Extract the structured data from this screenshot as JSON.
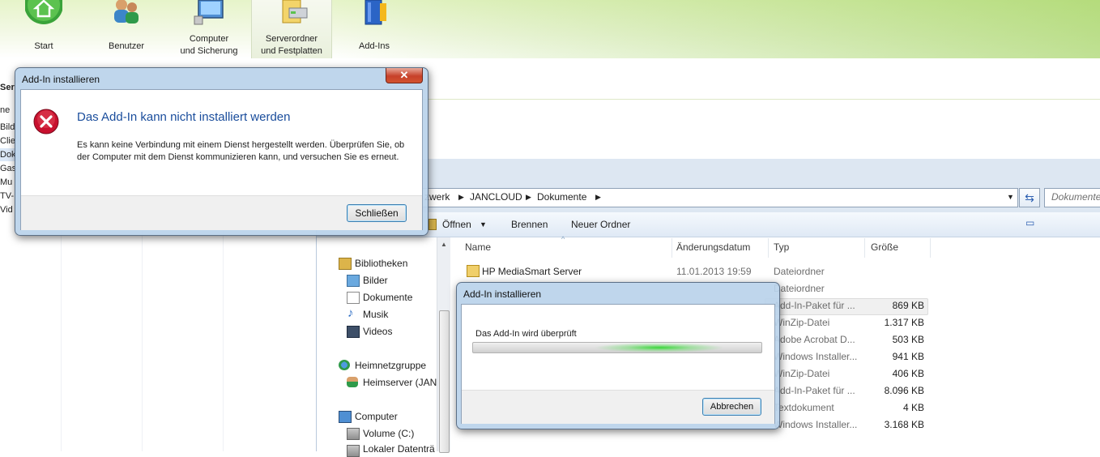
{
  "toolbar": {
    "items": [
      {
        "label": "Start",
        "icon": "home-icon"
      },
      {
        "label": "Benutzer",
        "icon": "users-icon"
      },
      {
        "label": "Computer\nund Sicherung",
        "line1": "Computer",
        "line2": "und Sicherung",
        "icon": "computer-icon"
      },
      {
        "label": "Serverordner und Festplatten",
        "line1": "Serverordner",
        "line2": "und Festplatten",
        "icon": "server-folder-icon"
      },
      {
        "label": "Add-Ins",
        "icon": "addins-icon"
      }
    ]
  },
  "dashboard_left": {
    "heading": "Ser",
    "subheading": "ne",
    "items": [
      "Bild",
      "Clie",
      "Dok",
      "Gas",
      "Mu",
      "TV-",
      "Vid"
    ]
  },
  "explorer": {
    "breadcrumb": [
      "zwerk",
      "JANCLOUD",
      "Dokumente"
    ],
    "search_placeholder": "Dokumente",
    "commands": [
      "Öffnen",
      "Brennen",
      "Neuer Ordner"
    ],
    "nav": {
      "groups": [
        {
          "label": "Bibliotheken",
          "icon": "library-icon",
          "items": [
            {
              "label": "Bilder",
              "icon": "pictures-icon"
            },
            {
              "label": "Dokumente",
              "icon": "documents-icon"
            },
            {
              "label": "Musik",
              "icon": "music-icon"
            },
            {
              "label": "Videos",
              "icon": "videos-icon"
            }
          ]
        },
        {
          "label": "Heimnetzgruppe",
          "icon": "homegroup-icon",
          "items": [
            {
              "label": "Heimserver (JAN",
              "icon": "user-icon"
            }
          ]
        },
        {
          "label": "Computer",
          "icon": "computer-icon",
          "items": [
            {
              "label": "Volume (C:)",
              "icon": "drive-icon"
            },
            {
              "label": "Lokaler Datenträ",
              "icon": "drive-icon"
            }
          ]
        }
      ]
    },
    "columns": [
      "Name",
      "Änderungsdatum",
      "Typ",
      "Größe"
    ],
    "rows": [
      {
        "name": "HP MediaSmart Server",
        "date": "11.01.2013 19:59",
        "type": "Dateiordner",
        "size": ""
      },
      {
        "name": "",
        "date": "",
        "type": "Dateiordner",
        "size": ""
      },
      {
        "name": "",
        "date": "",
        "type": "Add-In-Paket für ...",
        "size": "869 KB"
      },
      {
        "name": "",
        "date": "",
        "type": "WinZip-Datei",
        "size": "1.317 KB"
      },
      {
        "name": "",
        "date": "",
        "type": "Adobe Acrobat D...",
        "size": "503 KB"
      },
      {
        "name": "",
        "date": "",
        "type": "Windows Installer...",
        "size": "941 KB"
      },
      {
        "name": "",
        "date": "",
        "type": "WinZip-Datei",
        "size": "406 KB"
      },
      {
        "name": "",
        "date": "",
        "type": "Add-In-Paket für ...",
        "size": "8.096 KB"
      },
      {
        "name": "",
        "date": "",
        "type": "Textdokument",
        "size": "4 KB"
      },
      {
        "name": "",
        "date": "",
        "type": "Windows Installer...",
        "size": "3.168 KB"
      }
    ]
  },
  "error_dialog": {
    "title": "Add-In installieren",
    "heading": "Das Add-In kann nicht installiert werden",
    "message": "Es kann keine Verbindung mit einem Dienst hergestellt werden. Überprüfen Sie, ob der Computer mit dem Dienst kommunizieren kann, und versuchen Sie es erneut.",
    "button": "Schließen",
    "close_glyph": "✕"
  },
  "progress_dialog": {
    "title": "Add-In installieren",
    "status": "Das Add-In wird überprüft",
    "button": "Abbrechen"
  },
  "colors": {
    "accent": "#1a4d9c",
    "toolbar_green": "#8cc83c",
    "dialog_frame": "#bad2ea",
    "error_red": "#c8102e",
    "progress_green": "#30d630"
  }
}
